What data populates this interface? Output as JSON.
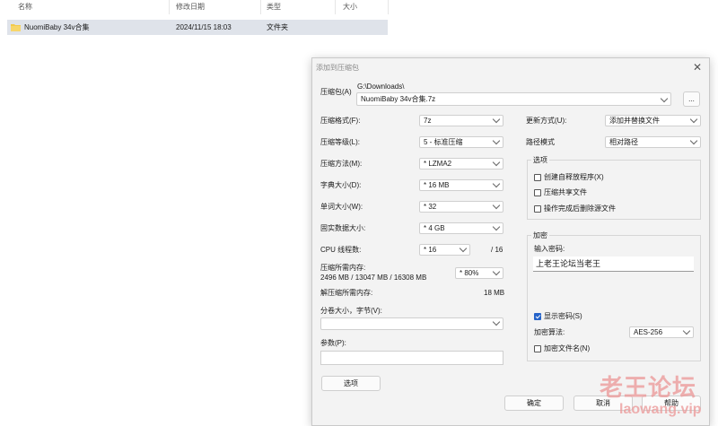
{
  "explorer": {
    "columns": [
      "名称",
      "修改日期",
      "类型",
      "大小"
    ],
    "file": {
      "name": "NuomiBaby 34v合集",
      "date": "2024/11/15 18:03",
      "type": "文件夹"
    }
  },
  "dialog": {
    "title": "添加到压缩包",
    "archive_label": "压缩包(A)",
    "archive_path": "G:\\Downloads\\",
    "archive_name": "NuomiBaby 34v合集.7z",
    "browse_label": "...",
    "left": {
      "format_label": "压缩格式(F):",
      "format_value": "7z",
      "level_label": "压缩等级(L):",
      "level_value": "5 - 标准压缩",
      "method_label": "压缩方法(M):",
      "method_value": "* LZMA2",
      "dict_label": "字典大小(D):",
      "dict_value": "* 16 MB",
      "word_label": "单词大小(W):",
      "word_value": "* 32",
      "solid_label": "固实数据大小:",
      "solid_value": "* 4 GB",
      "cpu_label": "CPU 线程数:",
      "cpu_value": "* 16",
      "cpu_total": "/ 16",
      "mem_label": "压缩所需内存:",
      "mem_detail": "2496 MB / 13047 MB / 16308 MB",
      "mem_value": "* 80%",
      "decomp_label": "解压缩所需内存:",
      "decomp_value": "18 MB",
      "split_label": "分卷大小，字节(V):",
      "params_label": "参数(P):",
      "options_button": "选项"
    },
    "right": {
      "update_label": "更新方式(U):",
      "update_value": "添加并替换文件",
      "path_label": "路径模式",
      "path_value": "相对路径",
      "options_group": "选项",
      "opt_sfx": "创建自释放程序(X)",
      "opt_shared": "压缩共享文件",
      "opt_delete": "操作完成后删除源文件",
      "encrypt_group": "加密",
      "password_label": "输入密码:",
      "password_value": "上老王论坛当老王",
      "show_password": "显示密码(S)",
      "algo_label": "加密算法:",
      "algo_value": "AES-256",
      "encrypt_names": "加密文件名(N)"
    },
    "buttons": {
      "ok": "确定",
      "cancel": "取消",
      "help": "帮助"
    }
  },
  "watermark": {
    "line1": "老王论坛",
    "line2": "laowang.vip"
  },
  "colors": {
    "accent": "#2563c9",
    "selection": "#dfe3ea",
    "folder": "#f2c94c"
  }
}
